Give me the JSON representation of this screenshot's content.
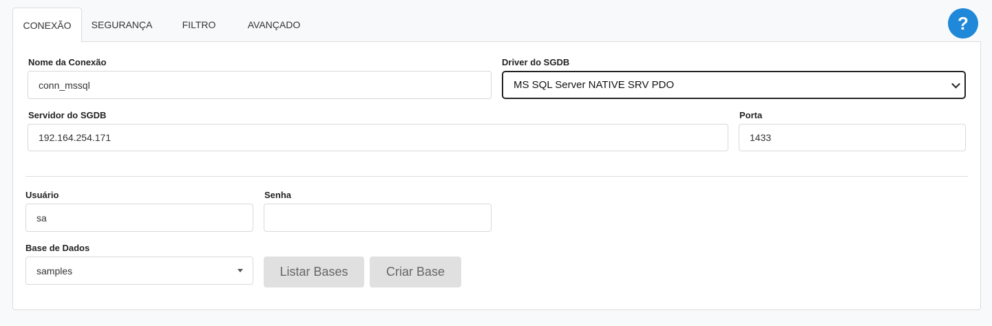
{
  "tabs": [
    {
      "label": "CONEXÃO",
      "active": true
    },
    {
      "label": "SEGURANÇA",
      "active": false
    },
    {
      "label": "FILTRO",
      "active": false
    },
    {
      "label": "AVANÇADO",
      "active": false
    }
  ],
  "help": {
    "glyph": "?"
  },
  "form": {
    "connection_name": {
      "label": "Nome da Conexão",
      "value": "conn_mssql"
    },
    "driver": {
      "label": "Driver do SGDB",
      "value": "MS SQL Server NATIVE SRV PDO"
    },
    "server": {
      "label": "Servidor do SGDB",
      "value": "192.164.254.171"
    },
    "port": {
      "label": "Porta",
      "value": "1433"
    },
    "user": {
      "label": "Usuário",
      "value": "sa"
    },
    "password": {
      "label": "Senha",
      "value": ""
    },
    "database": {
      "label": "Base de Dados",
      "value": "samples"
    }
  },
  "buttons": {
    "list_bases": "Listar Bases",
    "create_base": "Criar Base"
  },
  "colors": {
    "help_button": "#2088d8",
    "button_bg": "#e0e0e0",
    "page_bg": "#f8f9fa"
  }
}
